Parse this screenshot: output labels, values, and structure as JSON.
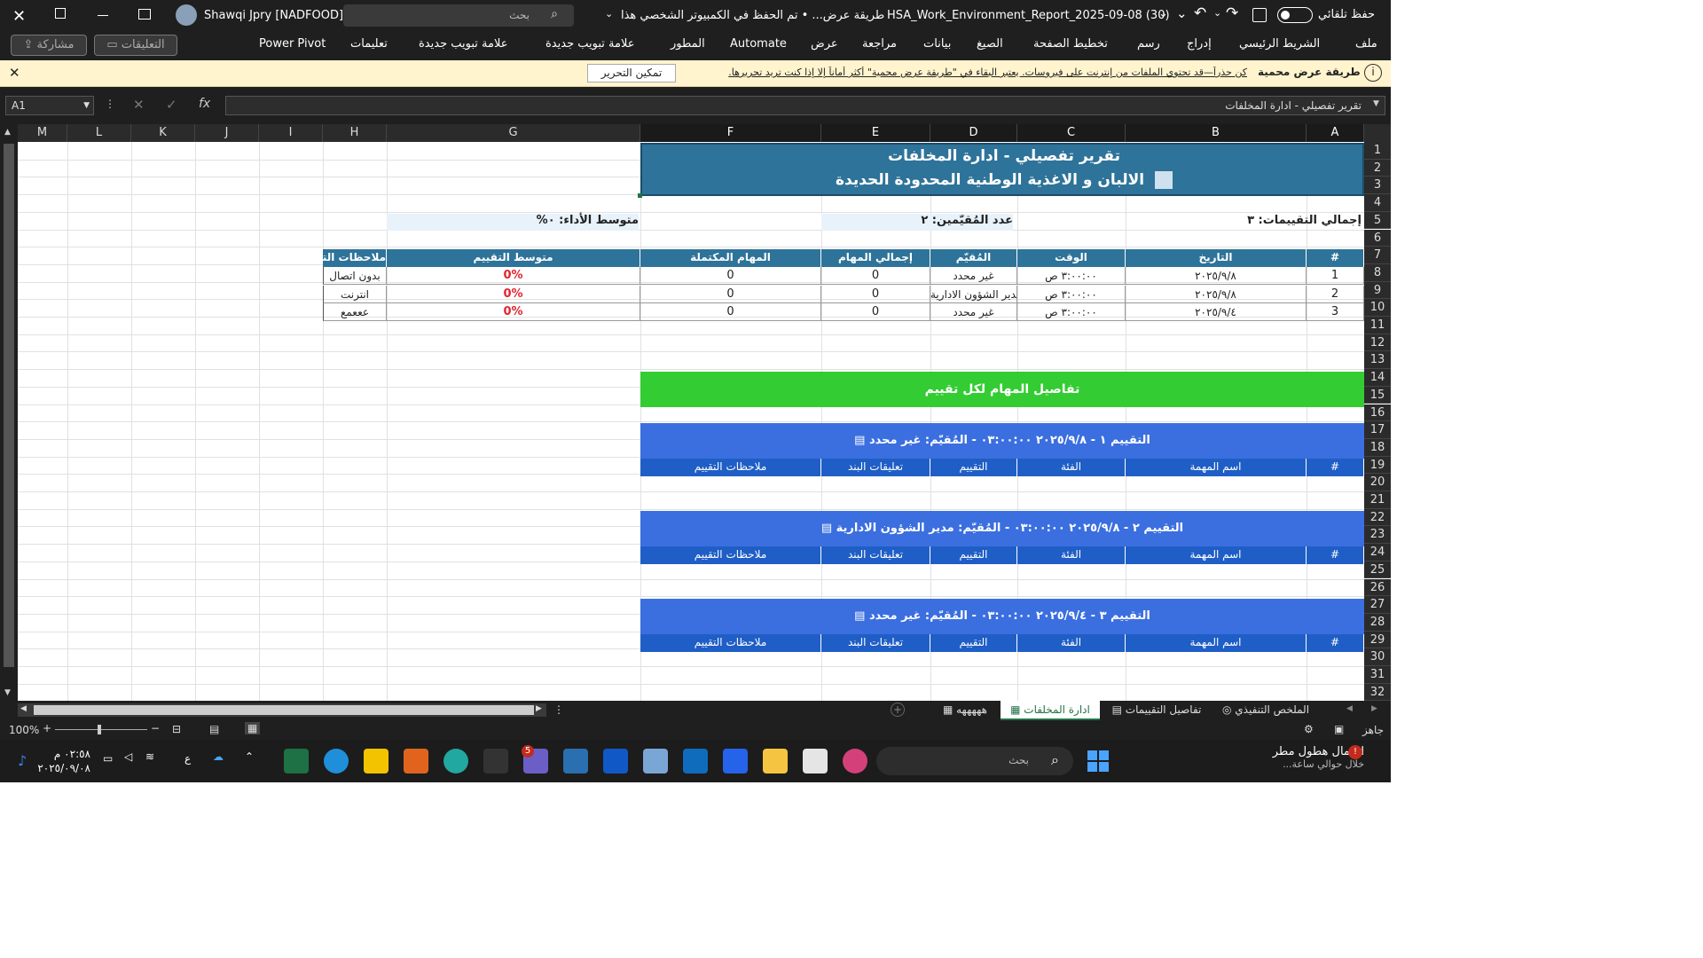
{
  "titlebar": {
    "autosave_label": "حفظ تلقائي",
    "file_title": "HSA_Work_Environment_Report_2025-09-08 (30)",
    "protected_view_short": "طريقة عرض...",
    "saved_status": "• تم الحفظ في الكمبيوتر الشخصي هذا",
    "search_placeholder": "بحث",
    "user_name": "Shawqi Jpry [NADFOOD]"
  },
  "ribbon": {
    "tabs": [
      "ملف",
      "الشريط الرئيسي",
      "إدراج",
      "رسم",
      "تخطيط الصفحة",
      "الصيغ",
      "بيانات",
      "مراجعة",
      "عرض",
      "Automate",
      "المطور",
      "علامة تبويب جديدة",
      "علامة تبويب جديدة",
      "تعليمات",
      "Power Pivot"
    ],
    "comments_label": "التعليقات",
    "share_label": "مشاركة"
  },
  "message_bar": {
    "title": "طريقة عرض محمية",
    "text": "كن حذراً—قد تحتوي الملفات من إنترنت على فيروسات. يعتبر البقاء في \"طريقة عرض محمية\" أكثر أماناً إلا إذا كنت تريد تحريرها.",
    "enable_button": "تمكين التحرير"
  },
  "formula_bar": {
    "name_box": "A1",
    "formula": "تقرير تفصيلي - ادارة المخلفات",
    "fx": "fx"
  },
  "columns": [
    "A",
    "B",
    "C",
    "D",
    "E",
    "F",
    "G",
    "H",
    "I",
    "J",
    "K",
    "L",
    "M"
  ],
  "rows": [
    "1",
    "2",
    "3",
    "4",
    "5",
    "6",
    "7",
    "8",
    "9",
    "10",
    "11",
    "12",
    "13",
    "14",
    "15",
    "16",
    "17",
    "18",
    "19",
    "20",
    "21",
    "22",
    "23",
    "24",
    "25",
    "26",
    "27",
    "28",
    "29",
    "30",
    "31",
    "32"
  ],
  "report": {
    "title": "تقرير تفصيلي - ادارة المخلفات",
    "company": "الالبان و الاغذية الوطنية المحدودة الحديدة",
    "total_evals": "إجمالي التقييمات: ٣",
    "evaluators_count": "عدد المُقيّمين: ٢",
    "avg_performance": "متوسط الأداء: ٠%",
    "table_headers": [
      "#",
      "التاريخ",
      "الوقت",
      "المُقيّم",
      "إجمالي المهام",
      "المهام المكتملة",
      "متوسط التقييم",
      "ملاحظات التقييم"
    ],
    "rows": [
      {
        "n": "1",
        "date": "٢٠٢٥/٩/٨",
        "time": "٣:٠٠:٠٠ ص",
        "evaluator": "غير محدد",
        "total": "0",
        "completed": "0",
        "avg": "0%",
        "notes": "بدون اتصال"
      },
      {
        "n": "2",
        "date": "٢٠٢٥/٩/٨",
        "time": "٣:٠٠:٠٠ ص",
        "evaluator": "مدير الشؤون الادارية",
        "total": "0",
        "completed": "0",
        "avg": "0%",
        "notes": "انترنت"
      },
      {
        "n": "3",
        "date": "٢٠٢٥/٩/٤",
        "time": "٣:٠٠:٠٠ ص",
        "evaluator": "غير محدد",
        "total": "0",
        "completed": "0",
        "avg": "0%",
        "notes": "عععمع"
      }
    ],
    "details_title": "تفاصيل المهام لكل تقييم",
    "evals": [
      {
        "title": "التقييم ١ - ٢٠٢٥/٩/٨ ٠٣:٠٠:٠٠ - المُقيّم: غير محدد"
      },
      {
        "title": "التقييم ٢ - ٢٠٢٥/٩/٨ ٠٣:٠٠:٠٠ - المُقيّم: مدير الشؤون الادارية"
      },
      {
        "title": "التقييم ٣ - ٢٠٢٥/٩/٤ ٠٣:٠٠:٠٠ - المُقيّم: غير محدد"
      }
    ],
    "detail_headers": [
      "#",
      "اسم المهمة",
      "الفئة",
      "التقييم",
      "تعليقات البند",
      "ملاحظات التقييم"
    ]
  },
  "sheet_tabs": [
    "الملخص التنفيذي",
    "تفاصيل التقييمات",
    "ادارة المخلفات",
    "هههههه"
  ],
  "status": {
    "ready": "جاهز",
    "zoom": "100%"
  },
  "taskbar": {
    "weather_title": "احتمال هطول مطر",
    "weather_sub": "خلال حوالي ساعة...",
    "search_placeholder": "بحث",
    "time": "٠٢:٥٨ م",
    "date": "٢٠٢٥/٠٩/٠٨",
    "lang": "ع",
    "teams_badge": "5"
  }
}
